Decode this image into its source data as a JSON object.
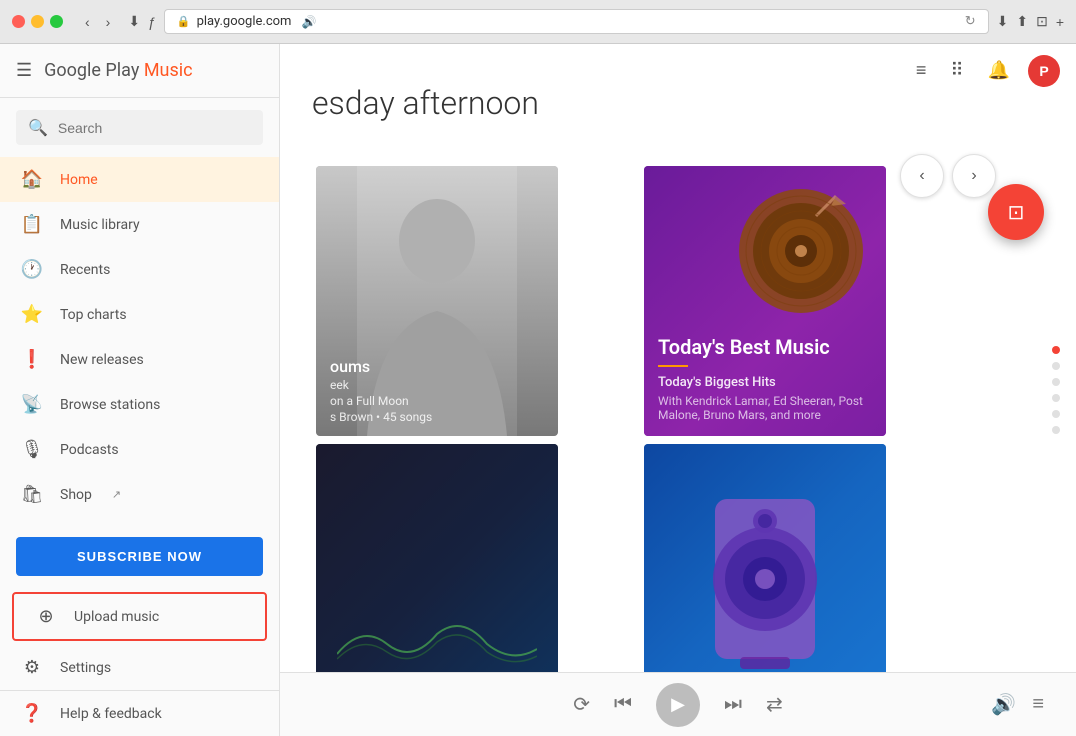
{
  "browser": {
    "url": "play.google.com",
    "url_display": "⚿ play.google.com"
  },
  "app": {
    "logo": "Google Play Music",
    "logo_prefix": "Google Play ",
    "logo_suffix": "Music"
  },
  "search": {
    "placeholder": "Search"
  },
  "nav": {
    "home": "Home",
    "music_library": "Music library",
    "recents": "Recents",
    "top_charts": "Top charts",
    "new_releases": "New releases",
    "browse_stations": "Browse stations",
    "podcasts": "Podcasts",
    "shop": "Shop",
    "upload_music": "Upload music",
    "settings": "Settings",
    "help_feedback": "Help & feedback"
  },
  "subscribe_btn": "SUBSCRIBE NOW",
  "hero": {
    "title": "esday afternoon"
  },
  "cards": [
    {
      "id": "card1",
      "type": "artist",
      "title": "oums",
      "subtitle_line1": "eek",
      "subtitle_line2": "on a Full Moon",
      "subtitle_line3": "s Brown • 45 songs"
    },
    {
      "id": "card2",
      "type": "playlist",
      "main_title": "Today's Best Music",
      "desc": "Today's Biggest Hits",
      "subdesc": "With Kendrick Lamar, Ed Sheeran, Post Malone, Bruno Mars, and more"
    },
    {
      "id": "card3",
      "type": "dark",
      "title": "",
      "subtitle": ""
    },
    {
      "id": "card4",
      "type": "navy",
      "title": "",
      "subtitle": ""
    }
  ],
  "dots": [
    {
      "active": true
    },
    {
      "active": false
    },
    {
      "active": false
    },
    {
      "active": false
    },
    {
      "active": false
    },
    {
      "active": false
    }
  ],
  "player": {
    "repeat_icon": "⟳",
    "prev_icon": "⏮",
    "play_icon": "▶",
    "next_icon": "⏭",
    "shuffle_icon": "⇄",
    "volume_icon": "🔊",
    "queue_icon": "≡"
  }
}
